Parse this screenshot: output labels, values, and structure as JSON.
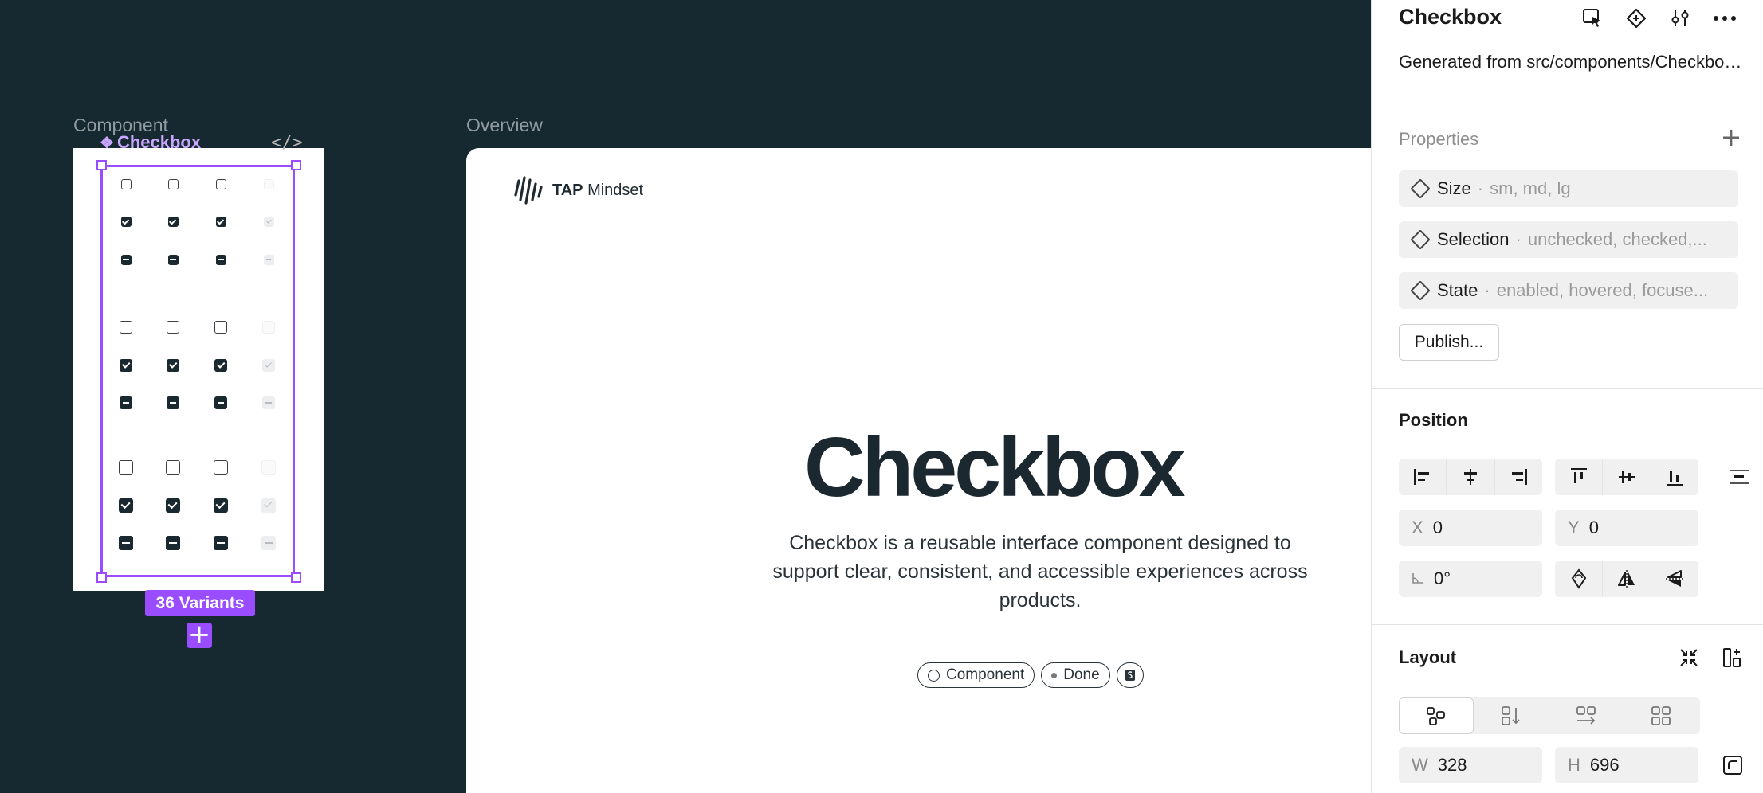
{
  "canvas": {
    "component_label": "Component",
    "overview_label": "Overview",
    "component_name": "Checkbox",
    "variants_badge": "36 Variants"
  },
  "overview": {
    "brand_bold": "TAP",
    "brand_rest": "Mindset",
    "title": "Checkbox",
    "description": "Checkbox is a reusable interface component designed to support clear, consistent, and accessible experiences across products.",
    "tag_component": "Component",
    "tag_done": "Done"
  },
  "panel": {
    "title": "Checkbox",
    "generated_from": "Generated from src/components/Checkbox/Checkbox.t...",
    "properties_heading": "Properties",
    "properties": [
      {
        "name": "Size",
        "values": "sm, md, lg"
      },
      {
        "name": "Selection",
        "values": "unchecked, checked,..."
      },
      {
        "name": "State",
        "values": "enabled, hovered, focuse..."
      }
    ],
    "separator": "·",
    "publish_label": "Publish...",
    "position_heading": "Position",
    "x_label": "X",
    "x_value": "0",
    "y_label": "Y",
    "y_value": "0",
    "rotation_value": "0°",
    "layout_heading": "Layout",
    "w_label": "W",
    "w_value": "328",
    "h_label": "H",
    "h_value": "696"
  },
  "icons": [
    "component-diamond-icon",
    "code-icon",
    "select-frame-icon",
    "component-insert-icon",
    "adjust-sliders-icon",
    "more-icon",
    "plus-icon",
    "align-left-icon",
    "align-center-h-icon",
    "align-right-icon",
    "align-top-icon",
    "align-center-v-icon",
    "align-bottom-icon",
    "distribute-icon",
    "angle-icon",
    "rotate-icon",
    "flip-horizontal-icon",
    "flip-vertical-icon",
    "collapse-icon",
    "add-layout-icon",
    "freeform-icon",
    "vertical-stack-icon",
    "horizontal-stack-icon",
    "grid-icon",
    "resize-icon"
  ],
  "colors": {
    "canvas": "#172930",
    "selection": "#9a4dff",
    "ink": "#1a2830"
  }
}
